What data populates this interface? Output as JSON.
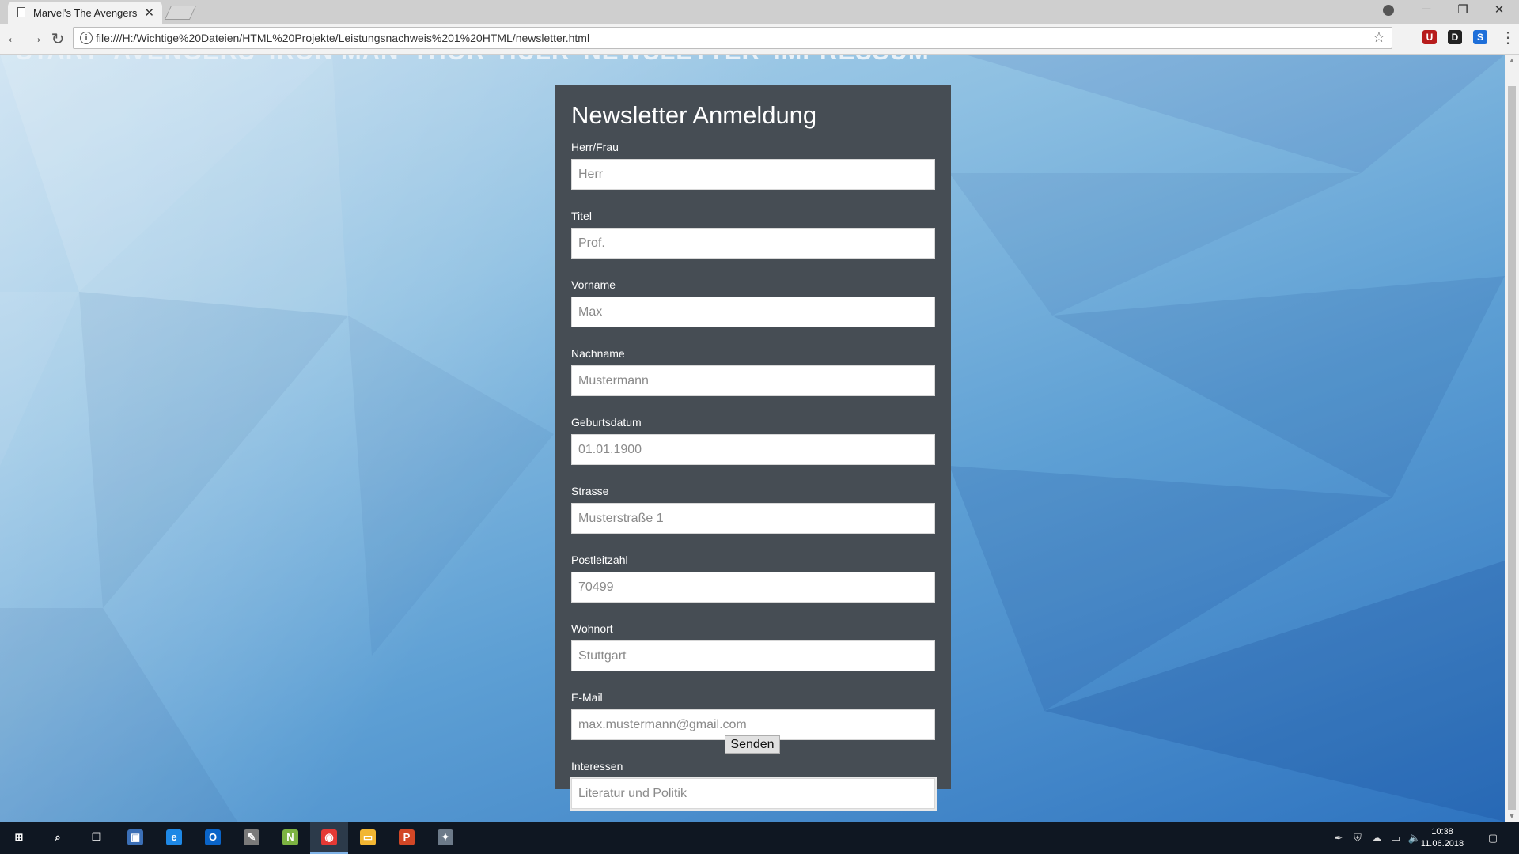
{
  "browser": {
    "tab_title": "Marvel's The Avengers",
    "tab_close": "✕",
    "url": "file:///H:/Wichtige%20Dateien/HTML%20Projekte/Leistungsnachweis%201%20HTML/newsletter.html",
    "window_controls": {
      "minimize": "─",
      "maximize": "❐",
      "close": "✕"
    },
    "nav": {
      "back": "←",
      "forward": "→",
      "reload": "↻",
      "info": "i",
      "star": "☆",
      "menu": "⋮"
    },
    "extensions": [
      {
        "icon": "ublock-icon",
        "glyph": "U",
        "color": "#b71c1c"
      },
      {
        "icon": "d-extension-icon",
        "glyph": "D",
        "color": "#222222"
      },
      {
        "icon": "s-extension-icon",
        "glyph": "S",
        "color": "#1e6fd9"
      }
    ]
  },
  "page": {
    "nav_items": [
      "START",
      "AVENGERS",
      "IRON MAN",
      "THOR",
      "HULK",
      "NEWSLETTER",
      "IMPRESSUM"
    ],
    "form": {
      "title": "Newsletter Anmeldung",
      "fields": [
        {
          "label": "Herr/Frau",
          "placeholder": "Herr"
        },
        {
          "label": "Titel",
          "placeholder": "Prof."
        },
        {
          "label": "Vorname",
          "placeholder": "Max"
        },
        {
          "label": "Nachname",
          "placeholder": "Mustermann"
        },
        {
          "label": "Geburtsdatum",
          "placeholder": "01.01.1900"
        },
        {
          "label": "Strasse",
          "placeholder": "Musterstraße 1"
        },
        {
          "label": "Postleitzahl",
          "placeholder": "70499"
        },
        {
          "label": "Wohnort",
          "placeholder": "Stuttgart"
        },
        {
          "label": "E-Mail",
          "placeholder": "max.mustermann@gmail.com"
        },
        {
          "label": "Interessen",
          "placeholder": "Literatur und Politik"
        }
      ],
      "submit_label": "Senden"
    }
  },
  "taskbar": {
    "apps": [
      {
        "name": "start-icon",
        "glyph": "⊞",
        "color": "transparent"
      },
      {
        "name": "search-icon",
        "glyph": "⌕",
        "color": "transparent"
      },
      {
        "name": "task-view-icon",
        "glyph": "❐",
        "color": "transparent"
      },
      {
        "name": "remote-desktop-icon",
        "glyph": "▣",
        "color": "#3b6fb6"
      },
      {
        "name": "internet-explorer-icon",
        "glyph": "e",
        "color": "#1e88e5"
      },
      {
        "name": "outlook-icon",
        "glyph": "O",
        "color": "#0a64c8"
      },
      {
        "name": "paint-icon",
        "glyph": "✎",
        "color": "#7a7a7a"
      },
      {
        "name": "notepad-plus-icon",
        "glyph": "N",
        "color": "#7cb342"
      },
      {
        "name": "chrome-icon",
        "glyph": "◉",
        "color": "#e53935"
      },
      {
        "name": "file-explorer-icon",
        "glyph": "▭",
        "color": "#f2b632"
      },
      {
        "name": "powerpoint-icon",
        "glyph": "P",
        "color": "#d24726"
      },
      {
        "name": "app-icon",
        "glyph": "✦",
        "color": "#6c7a89"
      }
    ],
    "active_app_index": 8,
    "tray": [
      {
        "name": "pen-icon",
        "glyph": "✒"
      },
      {
        "name": "shield-icon",
        "glyph": "⛨"
      },
      {
        "name": "cloud-icon",
        "glyph": "☁"
      },
      {
        "name": "network-icon",
        "glyph": "▭"
      },
      {
        "name": "volume-muted-icon",
        "glyph": "🔈"
      }
    ],
    "time": "10:38",
    "date": "11.06.2018",
    "notification_glyph": "▢"
  }
}
